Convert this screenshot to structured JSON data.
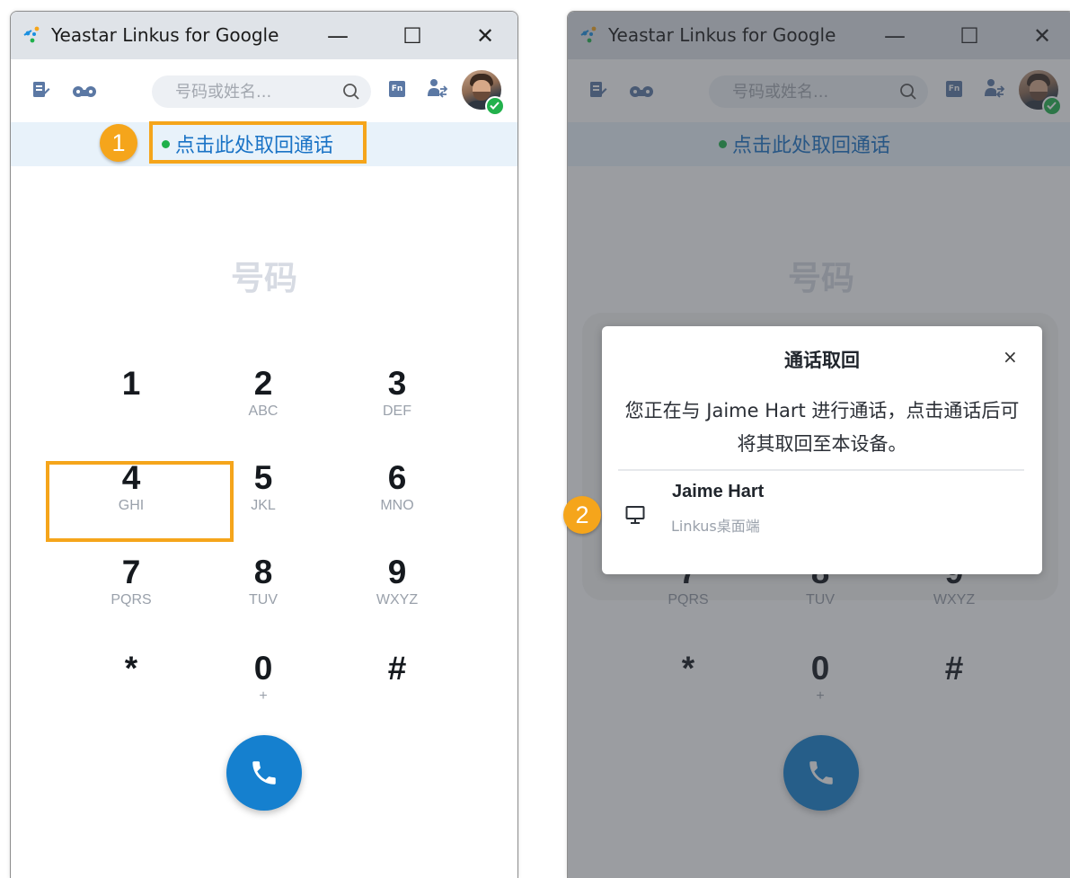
{
  "app": {
    "title": "Yeastar Linkus for Google",
    "min_glyph": "—",
    "max_glyph": "☐",
    "close_glyph": "✕"
  },
  "toolbar": {
    "search_placeholder": "号码或姓名...",
    "fn_label": "Fn"
  },
  "banner": {
    "text": "点击此处取回通话"
  },
  "dialpad": {
    "title": "号码",
    "keys": [
      {
        "digit": "1",
        "letters": ""
      },
      {
        "digit": "2",
        "letters": "ABC"
      },
      {
        "digit": "3",
        "letters": "DEF"
      },
      {
        "digit": "4",
        "letters": "GHI"
      },
      {
        "digit": "5",
        "letters": "JKL"
      },
      {
        "digit": "6",
        "letters": "MNO"
      },
      {
        "digit": "7",
        "letters": "PQRS"
      },
      {
        "digit": "8",
        "letters": "TUV"
      },
      {
        "digit": "9",
        "letters": "WXYZ"
      },
      {
        "digit": "*",
        "letters": ""
      },
      {
        "digit": "0",
        "letters": "+"
      },
      {
        "digit": "#",
        "letters": ""
      }
    ]
  },
  "modal": {
    "title": "通话取回",
    "close_glyph": "×",
    "description": "您正在与 Jaime Hart 进行通话，点击通话后可将其取回至本设备。",
    "device": {
      "name": "Jaime Hart",
      "type": "Linkus桌面端"
    }
  },
  "callouts": [
    "1",
    "2"
  ],
  "colors": {
    "accent": "#1580cf",
    "highlight": "#f5a51b",
    "online": "#22b14c",
    "banner_bg": "#e8f2fa"
  },
  "icons": [
    "yeastar-logo",
    "notes-icon",
    "voicemail-icon",
    "search-icon",
    "fn-icon",
    "transfer-icon",
    "phone-icon",
    "desktop-icon"
  ]
}
